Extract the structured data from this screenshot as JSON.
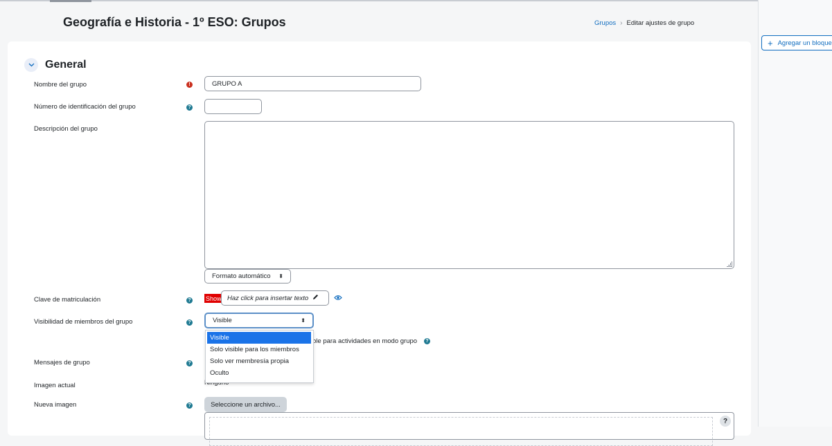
{
  "page": {
    "title": "Geografía e Historia - 1º ESO: Grupos"
  },
  "breadcrumb": {
    "link": "Grupos",
    "current": "Editar ajustes de grupo"
  },
  "drawer": {
    "add_block": "Agregar un bloque",
    "add_block_icon": "plus-icon"
  },
  "section": {
    "title": "General",
    "toggle_icon": "chevron-down-icon"
  },
  "form": {
    "group_name": {
      "label": "Nombre del grupo",
      "value": "GRUPO A",
      "required_icon": "exclamation-icon"
    },
    "id_number": {
      "label": "Número de identificación del grupo",
      "value": "",
      "help_icon": "question-icon"
    },
    "description": {
      "label": "Descripción del grupo",
      "value": ""
    },
    "format": {
      "selected": "Formato automático"
    },
    "enrolment_key": {
      "label": "Clave de matriculación",
      "show_tag": "Show",
      "placeholder": "Haz click para insertar texto",
      "edit_icon": "pencil-icon",
      "reveal_icon": "eye-icon"
    },
    "visibility": {
      "label": "Visibilidad de miembros del grupo",
      "selected": "Visible",
      "options": [
        "Visible",
        "Solo visible para los miembros",
        "Solo ver membresía propia",
        "Oculto"
      ],
      "behind_text": "ble para actividades en modo grupo"
    },
    "messaging": {
      "label": "Mensajes de grupo"
    },
    "current_image": {
      "label": "Imagen actual",
      "value": "Ninguno"
    },
    "new_image": {
      "label": "Nueva imagen",
      "button": "Seleccione un archivo...",
      "help_glyph": "?"
    }
  },
  "colors": {
    "accent": "#0f6cbf",
    "required": "#ca3120",
    "help": "#1f7a92",
    "selected_option": "#1a73e8",
    "show_tag": "#e00000"
  }
}
